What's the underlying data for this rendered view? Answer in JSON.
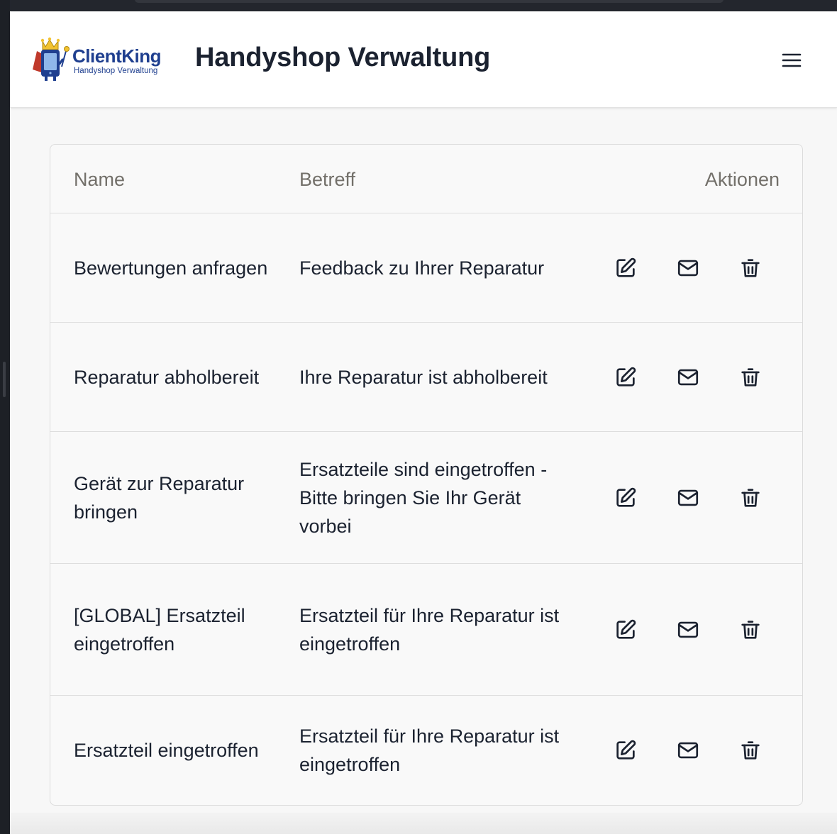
{
  "app": {
    "logo_name": "ClientKing",
    "logo_subtitle": "Handyshop Verwaltung",
    "title": "Handyshop Verwaltung",
    "menu_icon": "hamburger-menu-icon"
  },
  "table": {
    "headers": {
      "name": "Name",
      "subject": "Betreff",
      "actions": "Aktionen"
    },
    "rows": [
      {
        "name": "Bewertungen anfragen",
        "subject": "Feedback zu Ihrer Reparatur"
      },
      {
        "name": "Reparatur abholbereit",
        "subject": "Ihre Reparatur ist abholbereit"
      },
      {
        "name": "Gerät zur Reparatur bringen",
        "subject": "Ersatzteile sind eingetroffen - Bitte bringen Sie Ihr Gerät vorbei"
      },
      {
        "name": "[GLOBAL] Ersatzteil eingetroffen",
        "subject": "Ersatzteil für Ihre Reparatur ist eingetroffen"
      },
      {
        "name": "Ersatzteil eingetroffen",
        "subject": "Ersatzteil für Ihre Reparatur ist eingetroffen"
      }
    ],
    "action_icons": [
      "edit-icon",
      "mail-icon",
      "trash-icon"
    ]
  },
  "colors": {
    "brand_blue": "#1f3f8f",
    "text": "#1b2230",
    "header_text": "#73706a",
    "background": "#f7f7f7"
  }
}
